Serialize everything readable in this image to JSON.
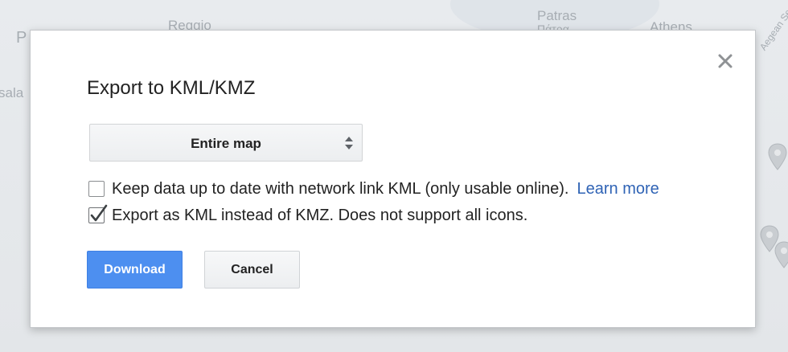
{
  "map": {
    "labels": [
      "Reggio",
      "Patras",
      "Πάτρα",
      "Athens",
      "Aegean Se",
      "P",
      "sala"
    ]
  },
  "dialog": {
    "title": "Export to KML/KMZ",
    "close_icon": "close-icon",
    "layer_select": {
      "value": "Entire map",
      "icon": "up-down-spinner-icon"
    },
    "options": [
      {
        "label": "Keep data up to date with network link KML (only usable online).",
        "checked": false,
        "link_text": "Learn more"
      },
      {
        "label": "Export as KML instead of KMZ. Does not support all icons.",
        "checked": true
      }
    ],
    "buttons": {
      "download": "Download",
      "cancel": "Cancel"
    },
    "colors": {
      "primary_button": "#4d8ff0",
      "link": "#2f63b5"
    }
  }
}
